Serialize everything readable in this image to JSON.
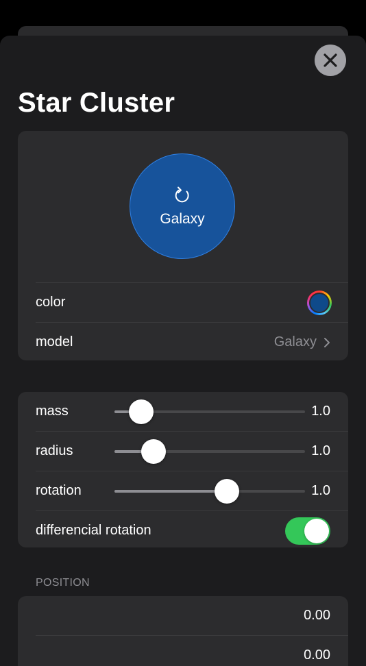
{
  "sheet": {
    "title": "Star Cluster"
  },
  "hero": {
    "label": "Galaxy",
    "color": "#17539b"
  },
  "appearance": {
    "color_label": "color",
    "color_value": "#0f4a8a",
    "model_label": "model",
    "model_value": "Galaxy"
  },
  "sliders": [
    {
      "label": "mass",
      "value": "1.0",
      "position": 0.14
    },
    {
      "label": "radius",
      "value": "1.0",
      "position": 0.205
    },
    {
      "label": "rotation",
      "value": "1.0",
      "position": 0.59
    }
  ],
  "toggle": {
    "label": "differencial rotation",
    "on": true
  },
  "position": {
    "header": "POSITION",
    "values": [
      "0.00",
      "0.00"
    ]
  },
  "colors": {
    "accent_green": "#34c759",
    "sheet_bg": "#1c1c1e",
    "group_bg": "#2c2c2e"
  }
}
